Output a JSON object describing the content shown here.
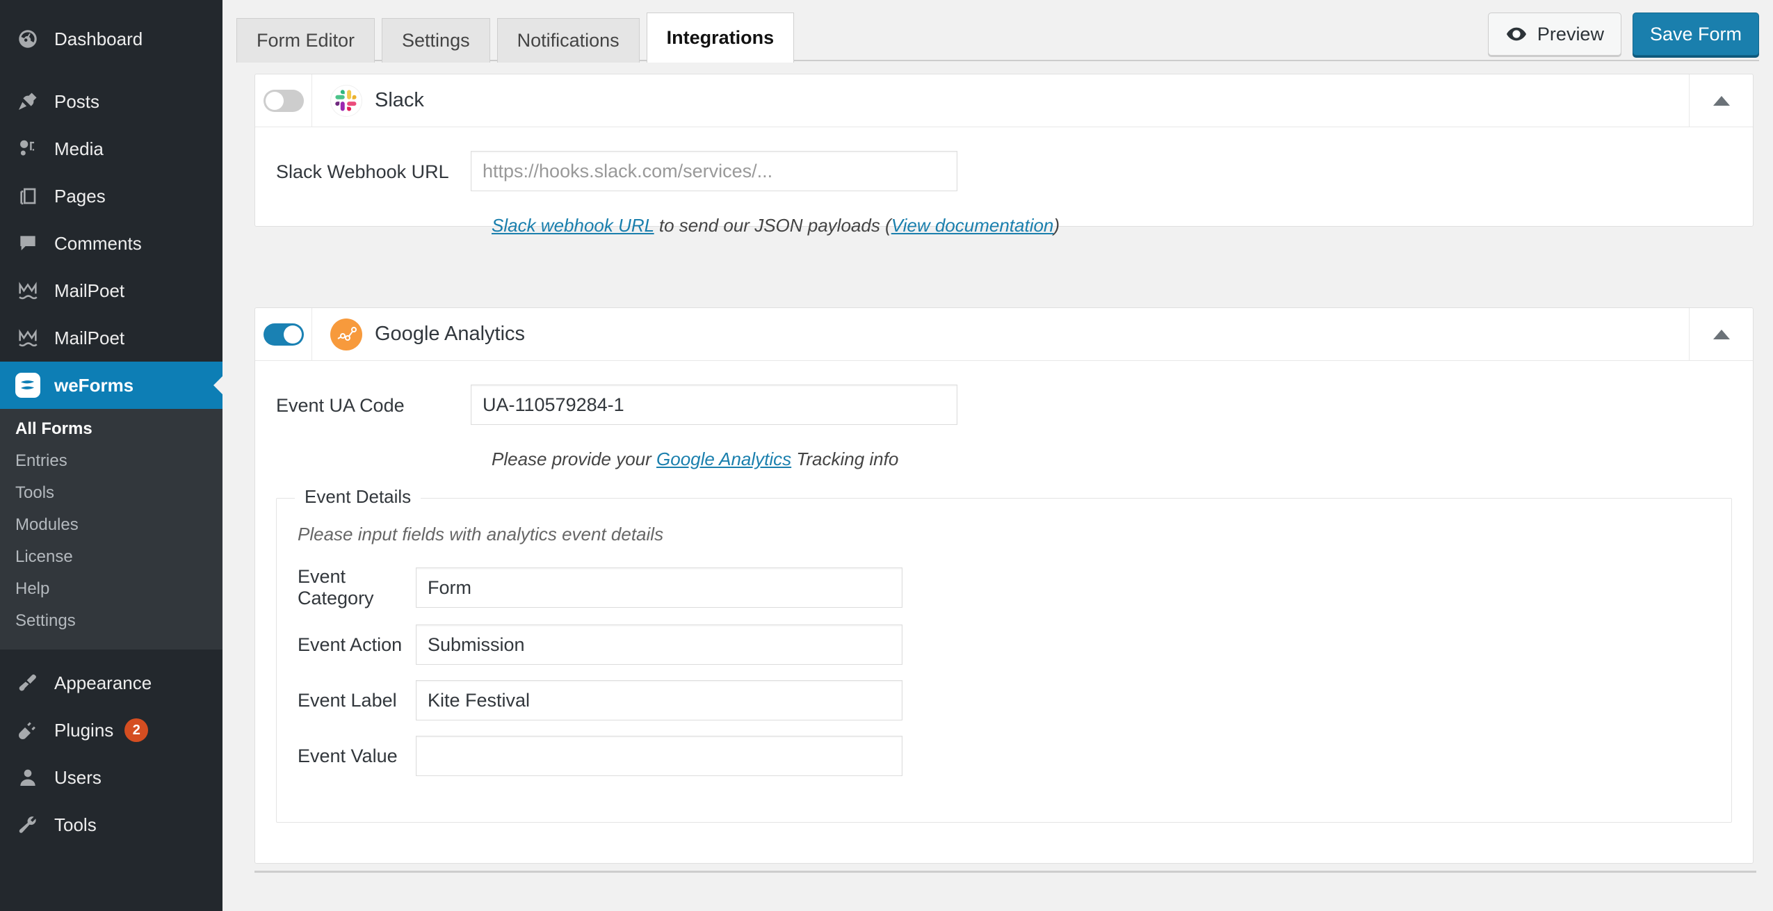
{
  "sidebar": {
    "items": [
      {
        "label": "Dashboard",
        "icon": "dashboard-icon",
        "badge": null
      },
      {
        "label": "Posts",
        "icon": "pin-icon",
        "badge": null
      },
      {
        "label": "Media",
        "icon": "media-icon",
        "badge": null
      },
      {
        "label": "Pages",
        "icon": "pages-icon",
        "badge": null
      },
      {
        "label": "Comments",
        "icon": "comment-icon",
        "badge": null
      },
      {
        "label": "MailPoet",
        "icon": "mailpoet-icon",
        "badge": null
      },
      {
        "label": "MailPoet",
        "icon": "mailpoet-icon",
        "badge": null
      },
      {
        "label": "weForms",
        "icon": "weforms-icon",
        "badge": null
      }
    ],
    "submenu": [
      {
        "label": "All Forms",
        "current": true
      },
      {
        "label": "Entries",
        "current": false
      },
      {
        "label": "Tools",
        "current": false
      },
      {
        "label": "Modules",
        "current": false
      },
      {
        "label": "License",
        "current": false
      },
      {
        "label": "Help",
        "current": false
      },
      {
        "label": "Settings",
        "current": false
      }
    ],
    "lower_items": [
      {
        "label": "Appearance",
        "icon": "brush-icon",
        "badge": null
      },
      {
        "label": "Plugins",
        "icon": "plug-icon",
        "badge": "2"
      },
      {
        "label": "Users",
        "icon": "user-icon",
        "badge": null
      },
      {
        "label": "Tools",
        "icon": "wrench-icon",
        "badge": null
      }
    ]
  },
  "tabs": [
    {
      "label": "Form Editor",
      "active": false
    },
    {
      "label": "Settings",
      "active": false
    },
    {
      "label": "Notifications",
      "active": false
    },
    {
      "label": "Integrations",
      "active": true
    }
  ],
  "actions": {
    "preview_label": "Preview",
    "save_label": "Save Form"
  },
  "colors": {
    "accent_blue": "#1a7fad",
    "toggle_on": "#1a81b3",
    "sidebar_bg": "#23282d",
    "submenu_bg": "#32373c",
    "badge_orange": "#d54e21",
    "annotation_red": "#ff2a20",
    "slack_icon_bg": "#ffffff",
    "ga_icon_bg": "#f79a3c"
  },
  "slack": {
    "title": "Slack",
    "enabled": false,
    "icon": "slack-icon",
    "webhook_label": "Slack Webhook URL",
    "webhook_value": "",
    "webhook_placeholder": "https://hooks.slack.com/services/...",
    "help_link": "Slack webhook URL",
    "help_mid": " to send our JSON payloads (",
    "help_doc_link": "View documentation",
    "help_end": ")"
  },
  "google_analytics": {
    "title": "Google Analytics",
    "enabled": true,
    "icon": "google-analytics-icon",
    "ua_label": "Event UA Code",
    "ua_value": "UA-110579284-1",
    "ua_placeholder": "",
    "help_pre": "Please provide your ",
    "help_link": "Google Analytics",
    "help_post": " Tracking info",
    "fieldset": {
      "legend": "Event Details",
      "note": "Please input fields with analytics event details",
      "rows": [
        {
          "label": "Event Category",
          "value": "Form",
          "placeholder": ""
        },
        {
          "label": "Event Action",
          "value": "Submission",
          "placeholder": ""
        },
        {
          "label": "Event Label",
          "value": "Kite Festival",
          "placeholder": ""
        },
        {
          "label": "Event Value",
          "value": "",
          "placeholder": ""
        }
      ]
    }
  }
}
